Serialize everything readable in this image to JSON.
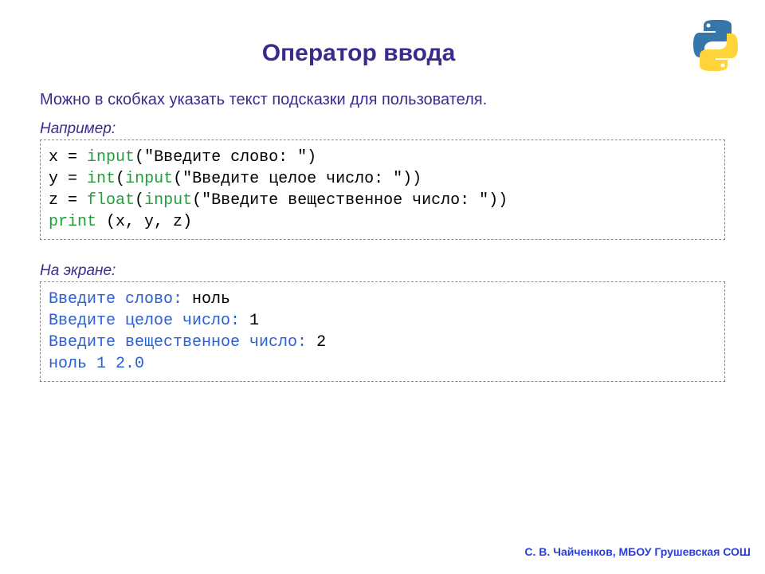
{
  "title": "Оператор ввода",
  "intro": "Можно в скобках указать текст подсказки для пользователя.",
  "label_example": "Например:",
  "label_output": "На экране:",
  "code": {
    "l1": {
      "var": "x",
      "eq": " = ",
      "func": "input",
      "open": "(",
      "str": "\"Введите слово: \"",
      "close": ")"
    },
    "l2": {
      "var": "y",
      "eq": " = ",
      "func1": "int",
      "open1": "(",
      "func2": "input",
      "open2": "(",
      "str": "\"Введите целое число: \"",
      "close": "))"
    },
    "l3": {
      "var": "z",
      "eq": " = ",
      "func1": "float",
      "open1": "(",
      "func2": "input",
      "open2": "(",
      "str": "\"Введите вещественное число: \"",
      "close": "))"
    },
    "l4": {
      "func": "print",
      "sp": " ",
      "open": "(",
      "args": "x, y, z",
      "close": ")"
    }
  },
  "output": {
    "l1": {
      "prompt": "Введите слово: ",
      "input": "ноль"
    },
    "l2": {
      "prompt": "Введите целое число: ",
      "input": "1"
    },
    "l3": {
      "prompt": "Введите вещественное число: ",
      "input": "2"
    },
    "l4": {
      "prompt": "ноль 1 2.0",
      "input": ""
    }
  },
  "footer": "С. В. Чайченков, МБОУ Грушевская СОШ"
}
